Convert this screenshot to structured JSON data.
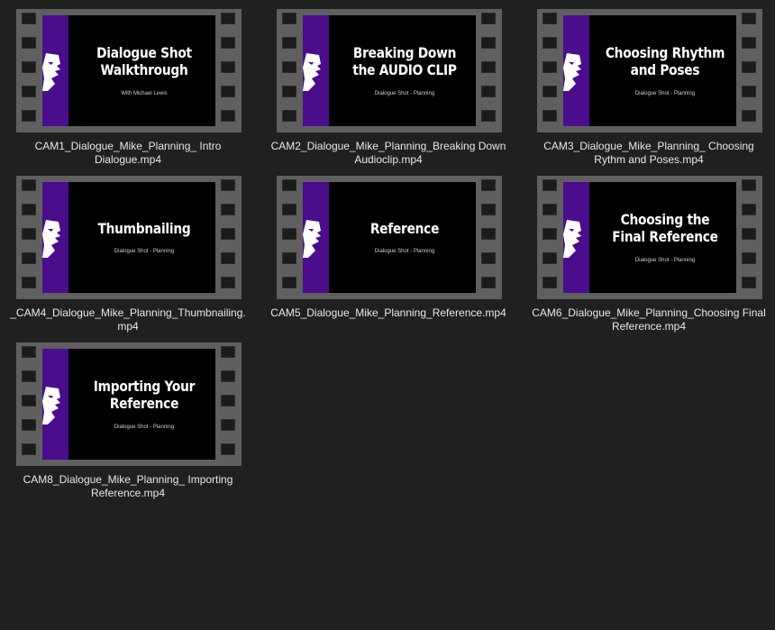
{
  "files": [
    {
      "name": "CAM1_Dialogue_Mike_Planning_ Intro\nDialogue.mp4",
      "title": "Dialogue Shot\nWalkthrough",
      "subtitle": "With Michael Lewis"
    },
    {
      "name": "CAM2_Dialogue_Mike_Planning_Breaking Down\nAudioclip.mp4",
      "title": "Breaking Down\nthe AUDIO CLIP",
      "subtitle": "Dialogue Shot - Planning"
    },
    {
      "name": "CAM3_Dialogue_Mike_Planning_ Choosing\nRythm and Poses.mp4",
      "title": "Choosing Rhythm\nand Poses",
      "subtitle": "Dialogue Shot - Planning"
    },
    {
      "name": "_CAM4_Dialogue_Mike_Planning_Thumbnailing.\nmp4",
      "title": "Thumbnailing",
      "subtitle": "Dialogue Shot - Planning"
    },
    {
      "name": "CAM5_Dialogue_Mike_Planning_Reference.mp4",
      "title": "Reference",
      "subtitle": "Dialogue Shot - Planning"
    },
    {
      "name": "CAM6_Dialogue_Mike_Planning_Choosing Final\nReference.mp4",
      "title": "Choosing the\nFinal Reference",
      "subtitle": "Dialogue Shot - Planning"
    },
    {
      "name": "CAM8_Dialogue_Mike_Planning_ Importing\nReference.mp4",
      "title": "Importing Your\nReference",
      "subtitle": "Dialogue Shot - Planning"
    }
  ],
  "colors": {
    "background": "#202020",
    "film": "#5f5f5f",
    "band": "#4a0d8c"
  },
  "icons": {
    "thumbnail_overlay": "film-strip-icon"
  }
}
